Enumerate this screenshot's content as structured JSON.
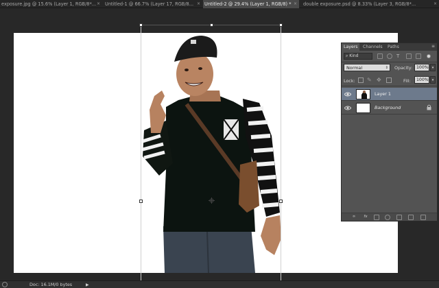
{
  "tabs": [
    {
      "label": "exposure.jpg @ 15.6% (Layer 1, RGB/8*...",
      "active": false,
      "close": "×"
    },
    {
      "label": "Untitled-1 @ 66.7% (Layer 17, RGB/8...",
      "active": false,
      "close": "×"
    },
    {
      "label": "Untitled-2 @ 29.4% (Layer 1, RGB/8) *",
      "active": true,
      "close": "×"
    },
    {
      "label": "double exposure.psd @ 8.33% (Layer 3, RGB/8*...",
      "active": false,
      "close": "×"
    }
  ],
  "layers_panel": {
    "tabs": [
      "Layers",
      "Channels",
      "Paths"
    ],
    "menu_glyph": "≡",
    "filter_kind": "Kind",
    "blend_mode": "Normal",
    "opacity_label": "Opacity:",
    "opacity_value": "100%",
    "lock_label": "Lock:",
    "fill_label": "Fill:",
    "fill_value": "100%",
    "layers": [
      {
        "name": "Layer 1",
        "selected": true,
        "visible": true
      },
      {
        "name": "Background",
        "selected": false,
        "visible": true,
        "locked": true
      }
    ]
  },
  "statusbar": {
    "doc_info": "Doc: 16.1M/0 bytes",
    "arrow": "▶"
  },
  "colors": {
    "workspace": "#282828",
    "panel": "#535353",
    "selected_layer": "#6d7a8c",
    "canvas": "#ffffff"
  }
}
